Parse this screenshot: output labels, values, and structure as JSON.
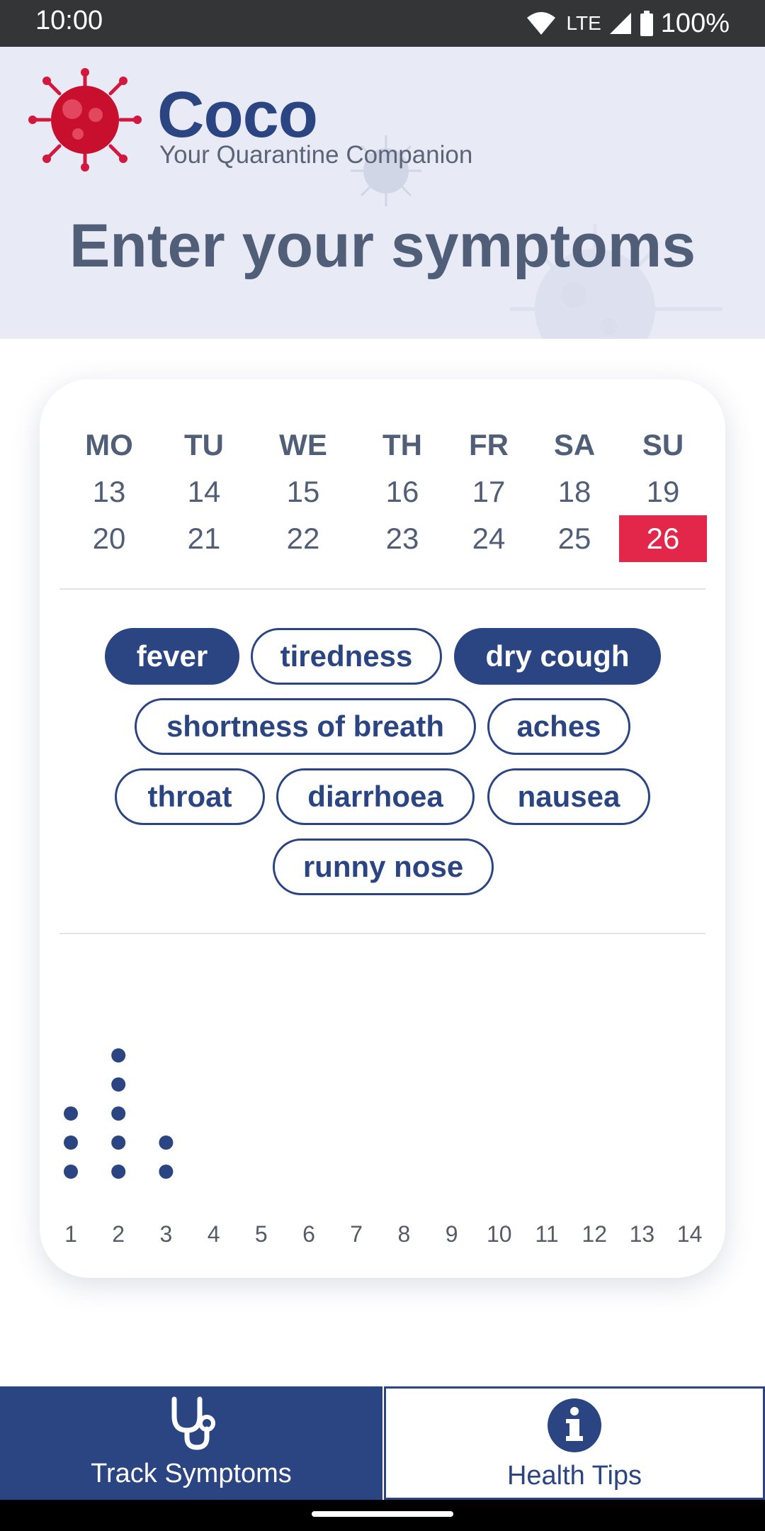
{
  "status": {
    "time": "10:00",
    "network": "LTE",
    "battery": "100%"
  },
  "app": {
    "brand": "Coco",
    "tagline": "Your Quarantine Companion"
  },
  "page": {
    "title": "Enter your symptoms"
  },
  "calendar": {
    "headers": [
      "MO",
      "TU",
      "WE",
      "TH",
      "FR",
      "SA",
      "SU"
    ],
    "weeks": [
      [
        "13",
        "14",
        "15",
        "16",
        "17",
        "18",
        "19"
      ],
      [
        "20",
        "21",
        "22",
        "23",
        "24",
        "25",
        "26"
      ]
    ],
    "today": "26"
  },
  "symptoms": [
    {
      "label": "fever",
      "selected": true
    },
    {
      "label": "tiredness",
      "selected": false
    },
    {
      "label": "dry cough",
      "selected": true
    },
    {
      "label": "shortness of breath",
      "selected": false
    },
    {
      "label": "aches",
      "selected": false
    },
    {
      "label": "throat",
      "selected": false
    },
    {
      "label": "diarrhoea",
      "selected": false
    },
    {
      "label": "nausea",
      "selected": false
    },
    {
      "label": "runny nose",
      "selected": false
    }
  ],
  "chart_data": {
    "type": "scatter",
    "x": [
      1,
      2,
      3,
      4,
      5,
      6,
      7,
      8,
      9,
      10,
      11,
      12,
      13,
      14
    ],
    "values": [
      3,
      5,
      2,
      0,
      0,
      0,
      0,
      0,
      0,
      0,
      0,
      0,
      0,
      0
    ],
    "tick_labels": [
      "1",
      "2",
      "3",
      "4",
      "5",
      "6",
      "7",
      "8",
      "9",
      "10",
      "11",
      "12",
      "13",
      "14"
    ],
    "title": "",
    "xlabel": "",
    "ylabel": ""
  },
  "nav": {
    "track_label": "Track Symptoms",
    "tips_label": "Health Tips"
  },
  "colors": {
    "brand": "#2b4583",
    "accent": "#e2274a",
    "header_bg": "#e8ebf6"
  }
}
